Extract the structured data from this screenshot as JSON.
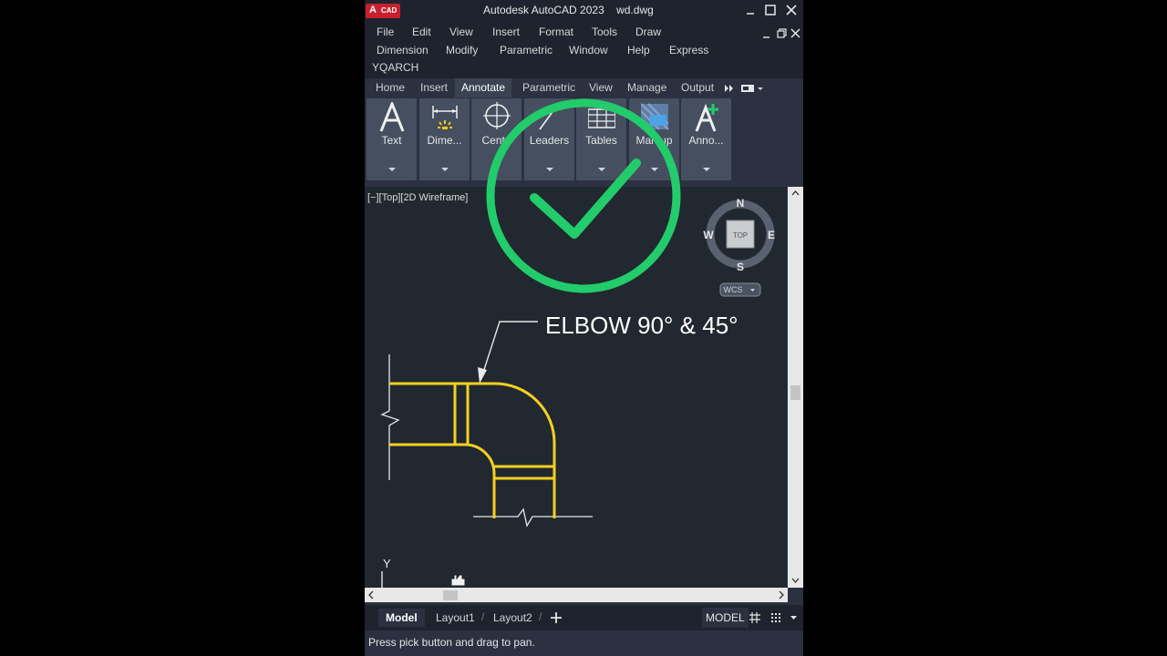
{
  "window": {
    "app_badge_a": "A",
    "app_badge_cad": "CAD",
    "title": "Autodesk AutoCAD 2023    wd.dwg"
  },
  "menu": {
    "row1": [
      "File",
      "Edit",
      "View",
      "Insert",
      "Format",
      "Tools",
      "Draw"
    ],
    "row2": [
      "Dimension",
      "Modify",
      "Parametric",
      "Window",
      "Help",
      "Express"
    ],
    "row3": [
      "YQARCH"
    ]
  },
  "ribbon_tabs": [
    {
      "label": "Home",
      "active": false
    },
    {
      "label": "Insert",
      "active": false
    },
    {
      "label": "Annotate",
      "active": true
    },
    {
      "label": "Parametric",
      "active": false
    },
    {
      "label": "View",
      "active": false
    },
    {
      "label": "Manage",
      "active": false
    },
    {
      "label": "Output",
      "active": false
    }
  ],
  "ribbon_buttons": [
    {
      "label": "Text",
      "icon": "text-icon"
    },
    {
      "label": "Dime...",
      "icon": "dimension-icon"
    },
    {
      "label": "Cente",
      "icon": "centermark-icon"
    },
    {
      "label": "Leaders",
      "icon": "leader-icon"
    },
    {
      "label": "Tables",
      "icon": "table-icon"
    },
    {
      "label": "Markup",
      "icon": "markup-icon"
    },
    {
      "label": "Anno...",
      "icon": "annotation-scale-icon"
    }
  ],
  "viewport": {
    "label": "[−][Top][2D Wireframe]",
    "annotation": "ELBOW 90° & 45°",
    "viewcube": {
      "n": "N",
      "s": "S",
      "e": "E",
      "w": "W",
      "face": "TOP",
      "wcs": "WCS"
    },
    "ucs_y": "Y",
    "colors": {
      "drawing": "#f5d020",
      "checkmark": "#22cc6a",
      "background": "#212830"
    }
  },
  "layout_tabs": [
    {
      "label": "Model",
      "active": true
    },
    {
      "label": "Layout1",
      "active": false
    },
    {
      "label": "Layout2",
      "active": false
    }
  ],
  "status": {
    "model_label": "MODEL",
    "prompt": "Press pick button and drag to pan."
  }
}
